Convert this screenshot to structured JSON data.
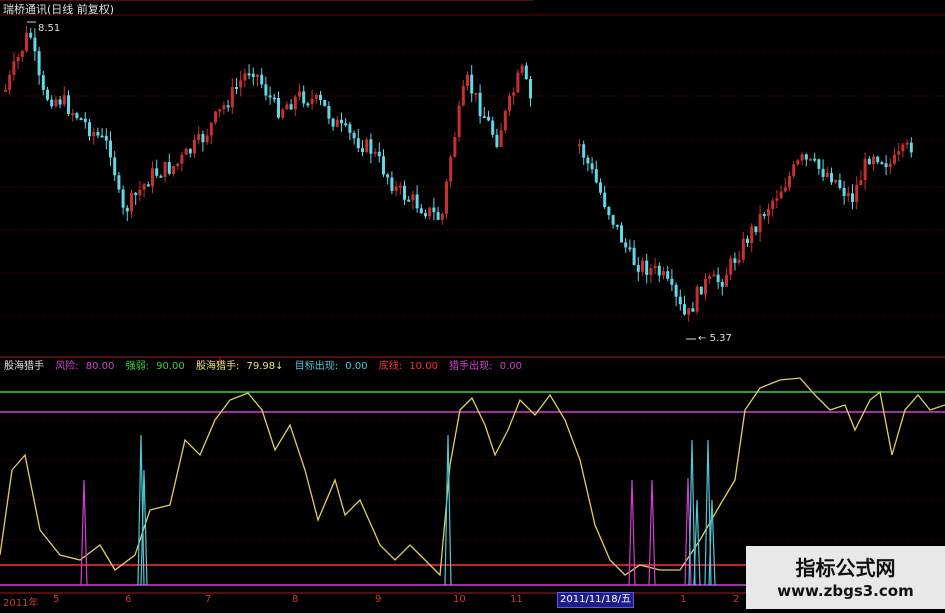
{
  "window": {
    "title": "瑞桥通讯(日线 前复权)"
  },
  "price_panel": {
    "high_label": "8.51",
    "low_label": "5.37"
  },
  "indicator_legend": [
    {
      "name": "股海猎手",
      "value": "",
      "color": "#e0e0e0"
    },
    {
      "name": "风险:",
      "value": "80.00",
      "color": "#d040d0"
    },
    {
      "name": "强弱:",
      "value": "90.00",
      "color": "#40d040"
    },
    {
      "name": "股海猎手:",
      "value": "79.98↓",
      "color": "#e8e070"
    },
    {
      "name": "目标出现:",
      "value": "0.00",
      "color": "#50c8d8"
    },
    {
      "name": "底线:",
      "value": "10.00",
      "color": "#ff3030"
    },
    {
      "name": "猎手出现:",
      "value": "0.00",
      "color": "#d040d0"
    }
  ],
  "time_axis": {
    "labels": [
      "2011年",
      "5",
      "6",
      "7",
      "8",
      "9",
      "10",
      "11",
      "1",
      "2"
    ],
    "highlight_date": "2011/11/18/五"
  },
  "watermark": {
    "title": "指标公式网",
    "url": "www.zbgs3.com"
  },
  "colors": {
    "up": "#c83030",
    "down": "#60d8e8",
    "yellow_line": "#e0d060",
    "risk_line": "#d040d0",
    "strength_line": "#40d040",
    "grid": "#6e0000"
  }
}
